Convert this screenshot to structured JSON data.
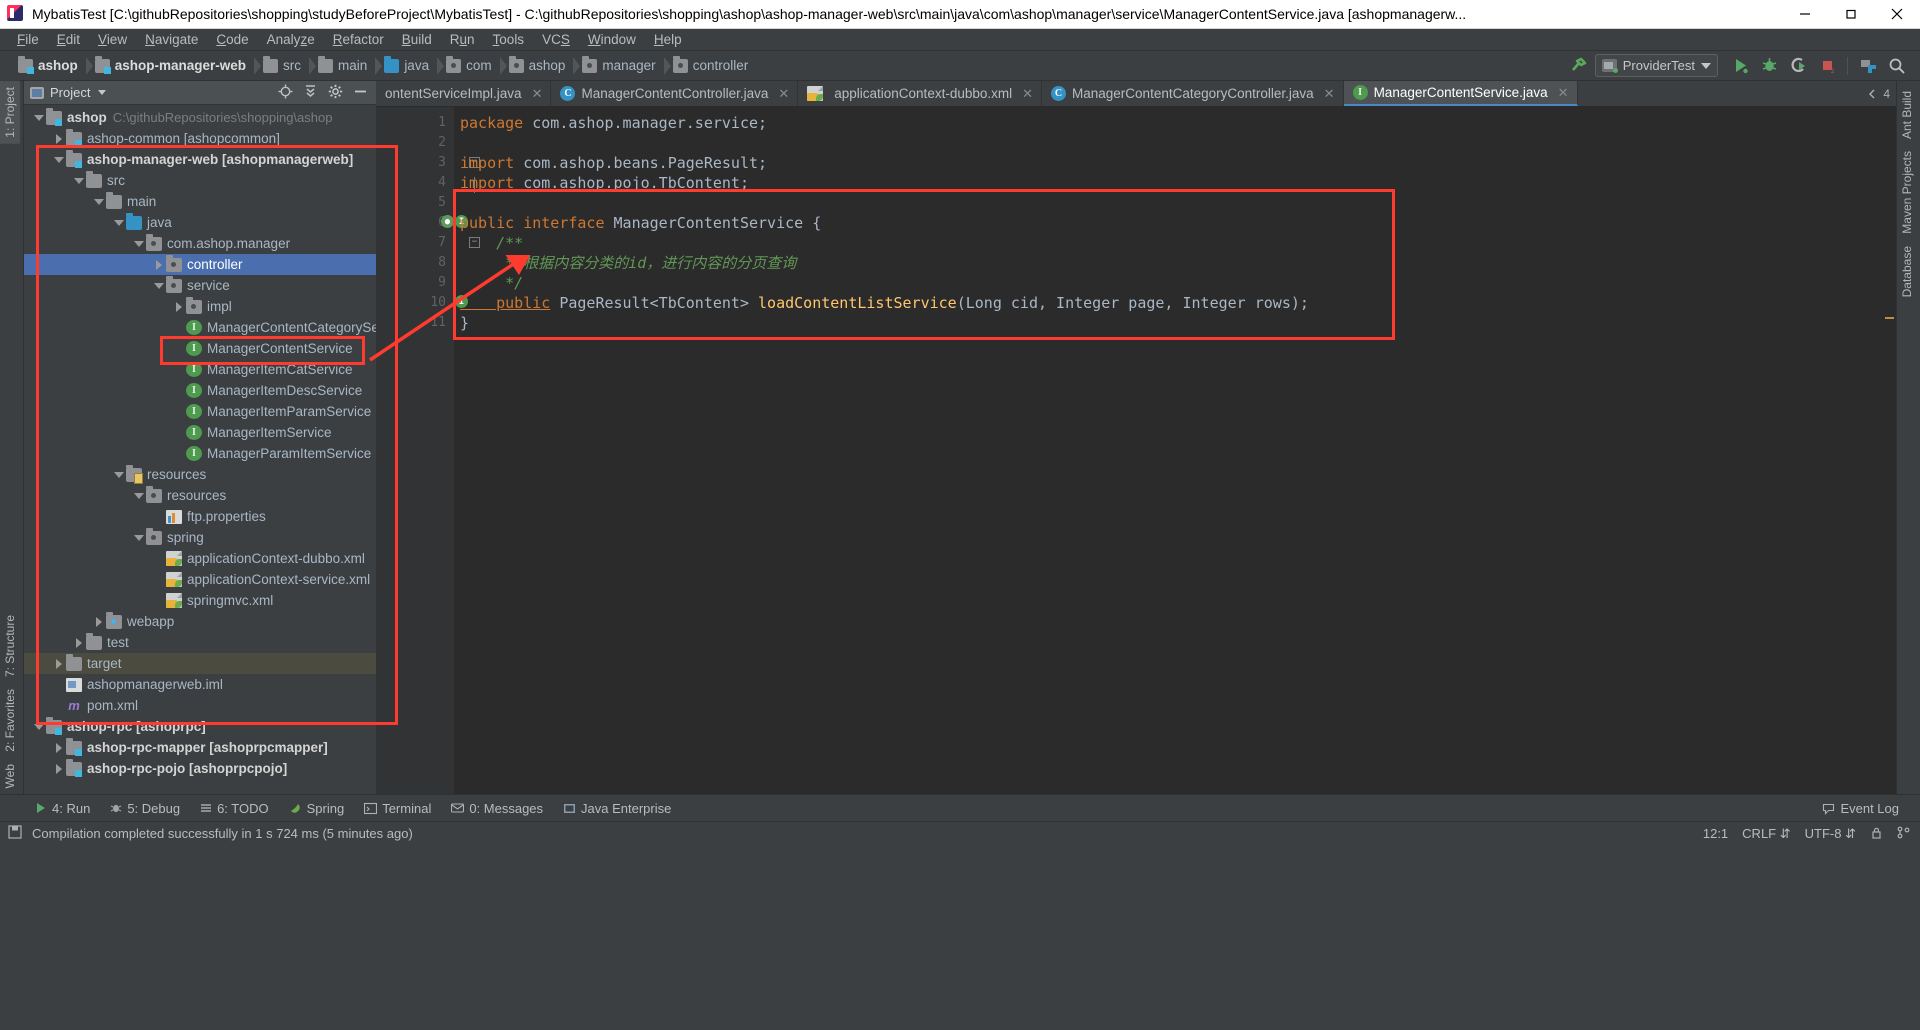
{
  "window": {
    "title": "MybatisTest [C:\\githubRepositories\\shopping\\studyBeforeProject\\MybatisTest] - C:\\githubRepositories\\shopping\\ashop\\ashop-manager-web\\src\\main\\java\\com\\ashop\\manager\\service\\ManagerContentService.java [ashopmanagerw...",
    "minimize": "minimize-icon",
    "maximize": "maximize-icon",
    "close": "close-icon"
  },
  "menu": [
    {
      "label": "File"
    },
    {
      "label": "Edit"
    },
    {
      "label": "View"
    },
    {
      "label": "Navigate"
    },
    {
      "label": "Code"
    },
    {
      "label": "Analyze"
    },
    {
      "label": "Refactor"
    },
    {
      "label": "Build"
    },
    {
      "label": "Run"
    },
    {
      "label": "Tools"
    },
    {
      "label": "VCS"
    },
    {
      "label": "Window"
    },
    {
      "label": "Help"
    }
  ],
  "breadcrumbs": [
    {
      "label": "ashop",
      "icon": "module-folder-icon",
      "bold": true
    },
    {
      "label": "ashop-manager-web",
      "icon": "module-folder-icon",
      "bold": true
    },
    {
      "label": "src",
      "icon": "folder-icon",
      "bold": false
    },
    {
      "label": "main",
      "icon": "folder-icon",
      "bold": false
    },
    {
      "label": "java",
      "icon": "source-folder-icon",
      "bold": false
    },
    {
      "label": "com",
      "icon": "package-icon",
      "bold": false
    },
    {
      "label": "ashop",
      "icon": "package-icon",
      "bold": false
    },
    {
      "label": "manager",
      "icon": "package-icon",
      "bold": false
    },
    {
      "label": "controller",
      "icon": "package-icon",
      "bold": false
    }
  ],
  "toolbar": {
    "build_icon": "hammer-build-icon",
    "run_config": "ProviderTest",
    "run_icon": "run-icon",
    "debug_icon": "debug-icon",
    "run_coverage_icon": "run-with-coverage-icon",
    "stop_icon": "stop-icon",
    "project_structure_icon": "project-structure-icon",
    "search_icon": "search-everywhere-icon"
  },
  "left_strip": {
    "top": [
      {
        "label": "1: Project"
      }
    ],
    "bottom": [
      {
        "label": "7: Structure"
      },
      {
        "label": "2: Favorites"
      },
      {
        "label": "Web"
      }
    ]
  },
  "right_strip": {
    "items": [
      {
        "label": "Ant Build"
      },
      {
        "label": "Maven Projects"
      },
      {
        "label": "Database"
      }
    ]
  },
  "project_panel": {
    "title": "Project",
    "locate_icon": "locate-icon",
    "collapse_icon": "collapse-all-icon",
    "settings_icon": "gear-icon",
    "hide_icon": "hide-icon",
    "tree": [
      {
        "indent": 0,
        "twist": "down",
        "icon": "module-folder-icon",
        "label": "ashop",
        "bold": true,
        "path": "C:\\githubRepositories\\shopping\\ashop"
      },
      {
        "indent": 1,
        "twist": "right",
        "icon": "module-folder-icon",
        "label": "ashop-common [ashopcommon]",
        "bold": false,
        "path": ""
      },
      {
        "indent": 1,
        "twist": "down",
        "icon": "module-folder-icon",
        "label": "ashop-manager-web [ashopmanagerweb]",
        "bold": true,
        "path": ""
      },
      {
        "indent": 2,
        "twist": "down",
        "icon": "folder-icon",
        "label": "src",
        "bold": false,
        "path": ""
      },
      {
        "indent": 3,
        "twist": "down",
        "icon": "folder-icon",
        "label": "main",
        "bold": false,
        "path": ""
      },
      {
        "indent": 4,
        "twist": "down",
        "icon": "source-folder-icon",
        "label": "java",
        "bold": false,
        "path": ""
      },
      {
        "indent": 5,
        "twist": "down",
        "icon": "package-icon",
        "label": "com.ashop.manager",
        "bold": false,
        "path": ""
      },
      {
        "indent": 6,
        "twist": "right",
        "icon": "package-icon",
        "label": "controller",
        "bold": false,
        "path": "",
        "selected": true
      },
      {
        "indent": 6,
        "twist": "down",
        "icon": "package-icon",
        "label": "service",
        "bold": false,
        "path": ""
      },
      {
        "indent": 7,
        "twist": "right",
        "icon": "package-icon",
        "label": "impl",
        "bold": false,
        "path": ""
      },
      {
        "indent": 7,
        "twist": "none",
        "icon": "interface-icon",
        "label": "ManagerContentCategoryService",
        "bold": false,
        "path": ""
      },
      {
        "indent": 7,
        "twist": "none",
        "icon": "interface-icon",
        "label": "ManagerContentService",
        "bold": false,
        "path": ""
      },
      {
        "indent": 7,
        "twist": "none",
        "icon": "interface-icon",
        "label": "ManagerItemCatService",
        "bold": false,
        "path": ""
      },
      {
        "indent": 7,
        "twist": "none",
        "icon": "interface-icon",
        "label": "ManagerItemDescService",
        "bold": false,
        "path": ""
      },
      {
        "indent": 7,
        "twist": "none",
        "icon": "interface-icon",
        "label": "ManagerItemParamService",
        "bold": false,
        "path": ""
      },
      {
        "indent": 7,
        "twist": "none",
        "icon": "interface-icon",
        "label": "ManagerItemService",
        "bold": false,
        "path": ""
      },
      {
        "indent": 7,
        "twist": "none",
        "icon": "interface-icon",
        "label": "ManagerParamItemService",
        "bold": false,
        "path": ""
      },
      {
        "indent": 4,
        "twist": "down",
        "icon": "resource-folder-icon",
        "label": "resources",
        "bold": false,
        "path": ""
      },
      {
        "indent": 5,
        "twist": "down",
        "icon": "package-icon",
        "label": "resources",
        "bold": false,
        "path": ""
      },
      {
        "indent": 6,
        "twist": "none",
        "icon": "properties-file-icon",
        "label": "ftp.properties",
        "bold": false,
        "path": ""
      },
      {
        "indent": 5,
        "twist": "down",
        "icon": "package-icon",
        "label": "spring",
        "bold": false,
        "path": ""
      },
      {
        "indent": 6,
        "twist": "none",
        "icon": "spring-xml-icon",
        "label": "applicationContext-dubbo.xml",
        "bold": false,
        "path": ""
      },
      {
        "indent": 6,
        "twist": "none",
        "icon": "spring-xml-icon",
        "label": "applicationContext-service.xml",
        "bold": false,
        "path": ""
      },
      {
        "indent": 6,
        "twist": "none",
        "icon": "spring-xml-icon",
        "label": "springmvc.xml",
        "bold": false,
        "path": ""
      },
      {
        "indent": 3,
        "twist": "right",
        "icon": "web-folder-icon",
        "label": "webapp",
        "bold": false,
        "path": ""
      },
      {
        "indent": 2,
        "twist": "right",
        "icon": "folder-icon",
        "label": "test",
        "bold": false,
        "path": ""
      },
      {
        "indent": 1,
        "twist": "right",
        "icon": "folder-icon",
        "label": "target",
        "bold": false,
        "path": "",
        "highlight": true
      },
      {
        "indent": 1,
        "twist": "none",
        "icon": "iml-file-icon",
        "label": "ashopmanagerweb.iml",
        "bold": false,
        "path": ""
      },
      {
        "indent": 1,
        "twist": "none",
        "icon": "pom-file-icon",
        "label": "pom.xml",
        "bold": false,
        "path": ""
      },
      {
        "indent": 0,
        "twist": "down",
        "icon": "module-folder-icon",
        "label": "ashop-rpc [ashoprpc]",
        "bold": true,
        "path": ""
      },
      {
        "indent": 1,
        "twist": "right",
        "icon": "module-folder-icon",
        "label": "ashop-rpc-mapper [ashoprpcmapper]",
        "bold": true,
        "path": ""
      },
      {
        "indent": 1,
        "twist": "right",
        "icon": "module-folder-icon",
        "label": "ashop-rpc-pojo [ashoprpcpojo]",
        "bold": true,
        "path": ""
      }
    ]
  },
  "editor": {
    "tabs": [
      {
        "label": "ontentServiceImpl.java",
        "icon": "class-icon",
        "active": false,
        "truncated": true
      },
      {
        "label": "ManagerContentController.java",
        "icon": "class-icon",
        "active": false
      },
      {
        "label": "applicationContext-dubbo.xml",
        "icon": "spring-xml-icon",
        "active": false
      },
      {
        "label": "ManagerContentCategoryController.java",
        "icon": "class-icon",
        "active": false
      },
      {
        "label": "ManagerContentService.java",
        "icon": "interface-icon",
        "active": true
      }
    ],
    "tab_overflow": "4",
    "line_numbers": [
      "1",
      "2",
      "3",
      "4",
      "5",
      "6",
      "7",
      "8",
      "9",
      "10",
      "11"
    ],
    "code_lines": [
      {
        "n": 1,
        "tokens": [
          {
            "t": "package ",
            "c": "kw"
          },
          {
            "t": "com.ashop.manager.service;",
            "c": "pln"
          }
        ]
      },
      {
        "n": 2,
        "tokens": []
      },
      {
        "n": 3,
        "tokens": [
          {
            "t": "import ",
            "c": "kw"
          },
          {
            "t": "com.ashop.beans.PageResult;",
            "c": "pln"
          }
        ]
      },
      {
        "n": 4,
        "tokens": [
          {
            "t": "import ",
            "c": "kw"
          },
          {
            "t": "com.ashop.pojo.TbContent;",
            "c": "pln"
          }
        ]
      },
      {
        "n": 5,
        "tokens": []
      },
      {
        "n": 6,
        "tokens": [
          {
            "t": "public interface ",
            "c": "kw"
          },
          {
            "t": "ManagerContentService ",
            "c": "cls"
          },
          {
            "t": "{",
            "c": "pln"
          }
        ]
      },
      {
        "n": 7,
        "tokens": [
          {
            "t": "    /**",
            "c": "cmt"
          }
        ]
      },
      {
        "n": 8,
        "tokens": [
          {
            "t": "     * 根据内容分类的id，进行内容的分页查询",
            "c": "cmt"
          }
        ]
      },
      {
        "n": 9,
        "tokens": [
          {
            "t": "     */",
            "c": "cmt"
          }
        ]
      },
      {
        "n": 10,
        "tokens": [
          {
            "t": "    public",
            "c": "kw-u"
          },
          {
            "t": " PageResult<TbContent> ",
            "c": "pln"
          },
          {
            "t": "loadContentListService",
            "c": "mth"
          },
          {
            "t": "(Long cid, Integer page, Integer rows);",
            "c": "pln"
          }
        ]
      },
      {
        "n": 11,
        "tokens": [
          {
            "t": "}",
            "c": "pln"
          }
        ]
      }
    ],
    "gutter_icons": {
      "line6": [
        "implemented-by-icon",
        "overridden-icon"
      ],
      "line10": [
        "implemented-by-icon"
      ]
    }
  },
  "bottom_bar": {
    "items": [
      {
        "label": "4: Run",
        "icon": "run-icon"
      },
      {
        "label": "5: Debug",
        "icon": "debug-icon"
      },
      {
        "label": "6: TODO",
        "icon": "todo-icon"
      },
      {
        "label": "Spring",
        "icon": "spring-icon"
      },
      {
        "label": "Terminal",
        "icon": "terminal-icon"
      },
      {
        "label": "0: Messages",
        "icon": "messages-icon"
      },
      {
        "label": "Java Enterprise",
        "icon": "java-enterprise-icon"
      }
    ],
    "event_log": "Event Log",
    "event_log_icon": "balloon-icon"
  },
  "status_bar": {
    "icon": "save-all-icon",
    "message": "Compilation completed successfully in 1 s 724 ms (5 minutes ago)",
    "caret": "12:1",
    "line_sep": "CRLF",
    "encoding": "UTF-8",
    "lock_icon": "lock-icon",
    "branch_icon": "branch-icon"
  },
  "colors": {
    "accent_blue": "#4b6eaf",
    "annotation_red": "#ff3b30",
    "editor_bg": "#2b2b2b",
    "panel_bg": "#3c3f41",
    "keyword_orange": "#cc7832",
    "method_yellow": "#ffc66d",
    "comment_green": "#629755"
  }
}
